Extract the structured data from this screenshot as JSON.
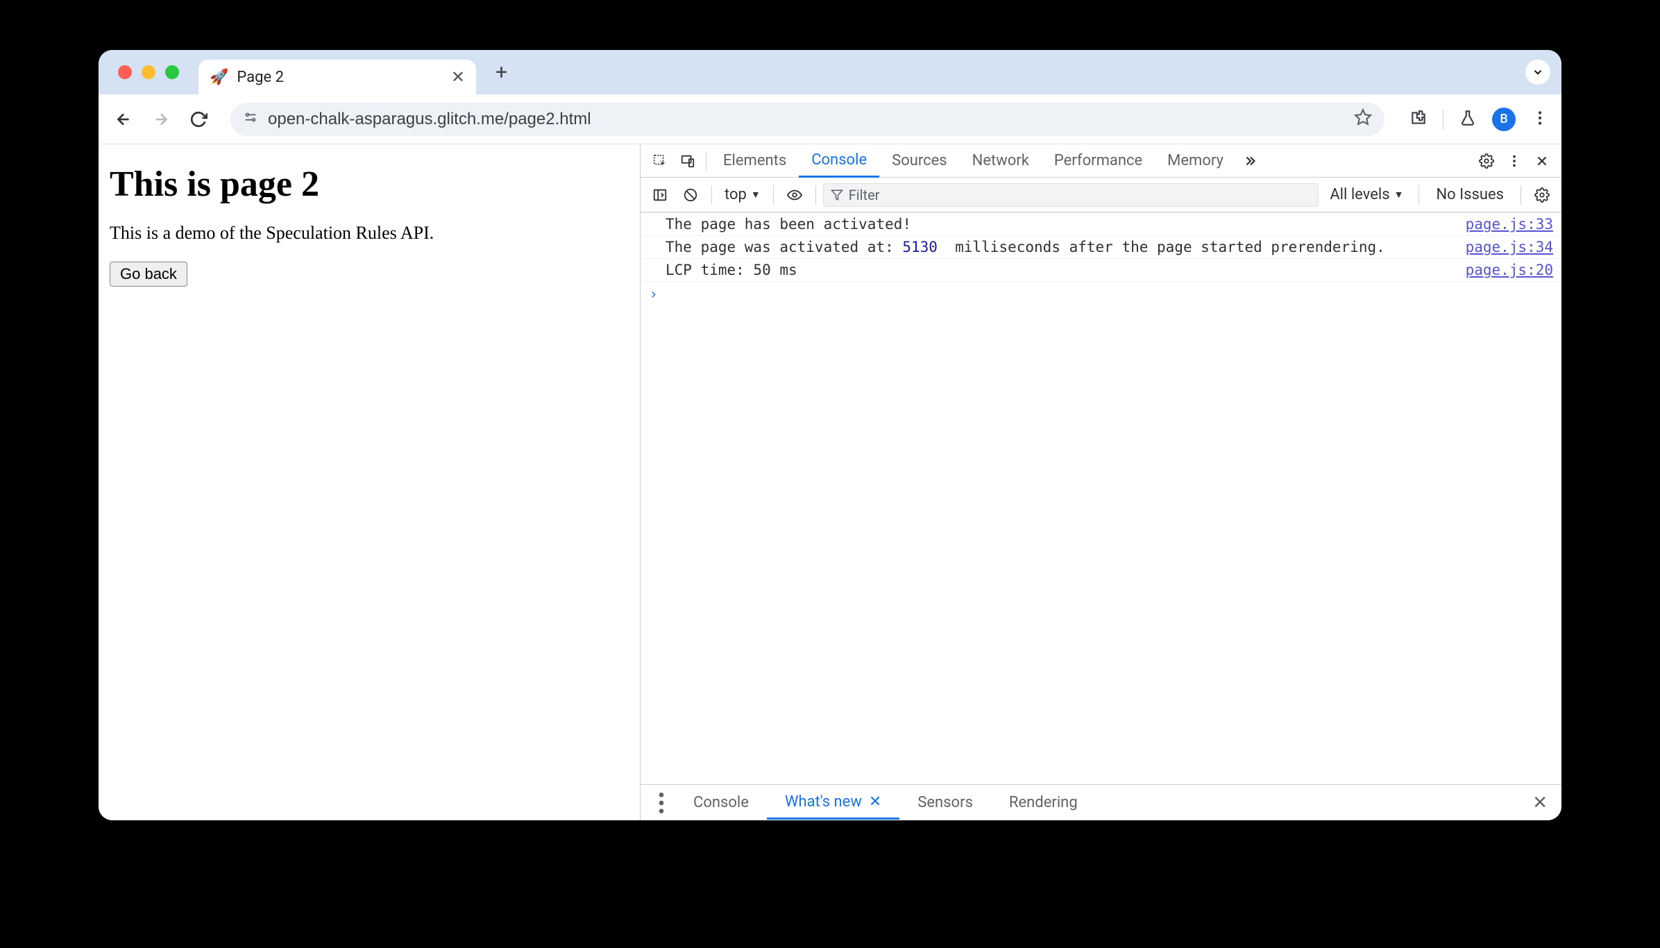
{
  "tab": {
    "favicon": "🚀",
    "title": "Page 2"
  },
  "url": "open-chalk-asparagus.glitch.me/page2.html",
  "avatar_letter": "B",
  "page": {
    "heading": "This is page 2",
    "paragraph": "This is a demo of the Speculation Rules API.",
    "button": "Go back"
  },
  "devtools": {
    "tabs": [
      "Elements",
      "Console",
      "Sources",
      "Network",
      "Performance",
      "Memory"
    ],
    "active_tab": "Console",
    "toolbar": {
      "context": "top",
      "filter_placeholder": "Filter",
      "levels": "All levels",
      "issues": "No Issues"
    },
    "messages": [
      {
        "text_pre": "The page has been activated!",
        "num": "",
        "text_post": "",
        "source": "page.js:33"
      },
      {
        "text_pre": "The page was activated at: ",
        "num": "5130",
        "text_post": "  milliseconds after the page started prerendering.",
        "source": "page.js:34"
      },
      {
        "text_pre": "LCP time: 50 ms",
        "num": "",
        "text_post": "",
        "source": "page.js:20"
      }
    ],
    "drawer": {
      "tabs": [
        "Console",
        "What's new",
        "Sensors",
        "Rendering"
      ],
      "active": "What's new"
    }
  }
}
